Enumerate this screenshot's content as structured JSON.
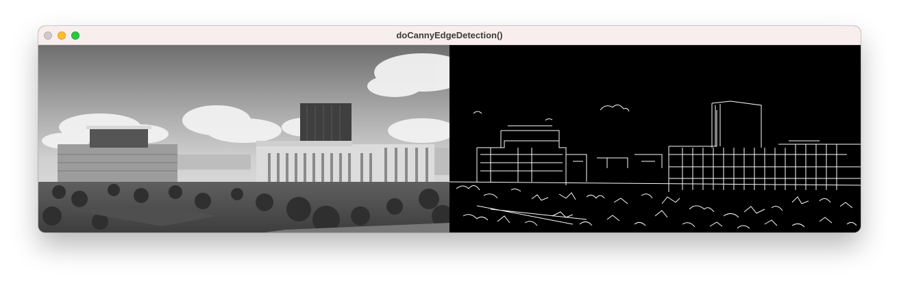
{
  "window": {
    "title": "doCannyEdgeDetection()"
  },
  "panels": {
    "left": {
      "kind": "grayscale-photo"
    },
    "right": {
      "kind": "canny-edge-map"
    }
  },
  "colors": {
    "titlebar": "#f8eeed",
    "close": "#cfc9c9",
    "minimize": "#fdbc2e",
    "maximize": "#29c840",
    "edge": "#ffffff",
    "edge_background": "#000000"
  }
}
